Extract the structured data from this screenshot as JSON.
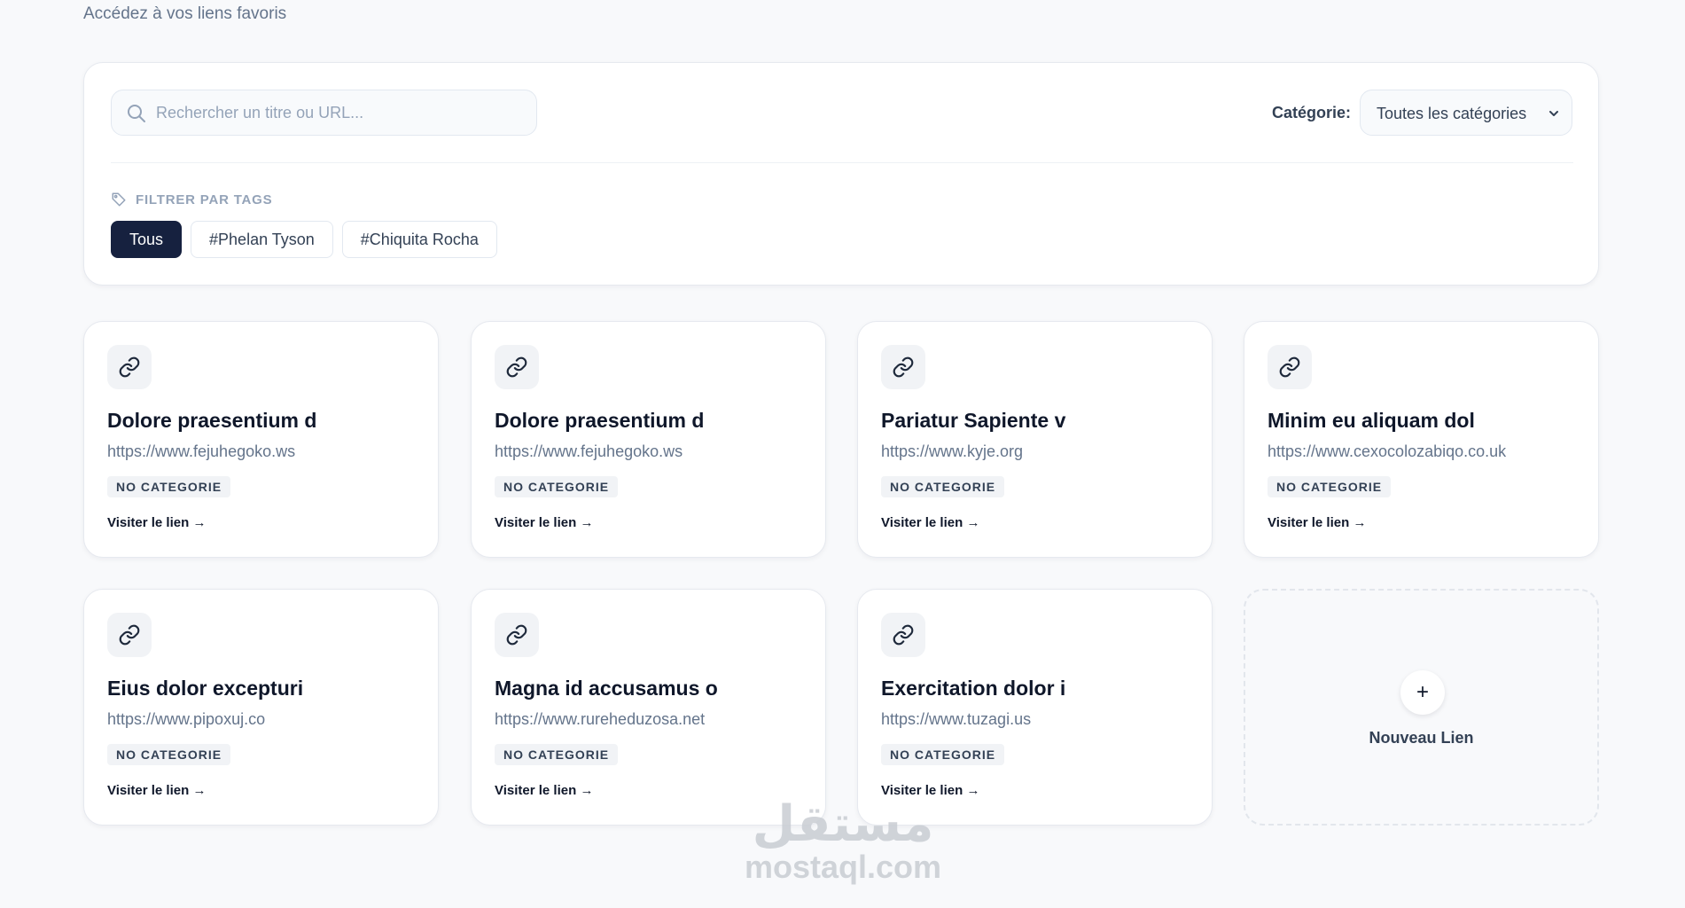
{
  "header": {
    "subtitle": "Accédez à vos liens favoris"
  },
  "search": {
    "placeholder": "Rechercher un titre ou URL..."
  },
  "category_filter": {
    "label": "Catégorie:",
    "selected": "Toutes les catégories"
  },
  "tags": {
    "heading": "FILTRER PAR TAGS",
    "items": [
      {
        "label": "Tous",
        "active": true
      },
      {
        "label": "#Phelan Tyson",
        "active": false
      },
      {
        "label": "#Chiquita Rocha",
        "active": false
      }
    ]
  },
  "links": [
    {
      "title": "Dolore praesentium d",
      "url": "https://www.fejuhegoko.ws",
      "category": "NO CATEGORIE",
      "action": "Visiter le lien →"
    },
    {
      "title": "Dolore praesentium d",
      "url": "https://www.fejuhegoko.ws",
      "category": "NO CATEGORIE",
      "action": "Visiter le lien →"
    },
    {
      "title": "Pariatur Sapiente v",
      "url": "https://www.kyje.org",
      "category": "NO CATEGORIE",
      "action": "Visiter le lien →"
    },
    {
      "title": "Minim eu aliquam dol",
      "url": "https://www.cexocolozabiqo.co.uk",
      "category": "NO CATEGORIE",
      "action": "Visiter le lien →"
    },
    {
      "title": "Eius dolor excepturi",
      "url": "https://www.pipoxuj.co",
      "category": "NO CATEGORIE",
      "action": "Visiter le lien →"
    },
    {
      "title": "Magna id accusamus o",
      "url": "https://www.rureheduzosa.net",
      "category": "NO CATEGORIE",
      "action": "Visiter le lien →"
    },
    {
      "title": "Exercitation dolor i",
      "url": "https://www.tuzagi.us",
      "category": "NO CATEGORIE",
      "action": "Visiter le lien →"
    }
  ],
  "new_link": {
    "icon": "+",
    "label": "Nouveau Lien"
  },
  "watermark": {
    "arabic": "مستقل",
    "latin": "mostaql.com"
  },
  "colors": {
    "accent": "#16213f",
    "muted": "#64748b",
    "background": "#f8f9fb"
  }
}
